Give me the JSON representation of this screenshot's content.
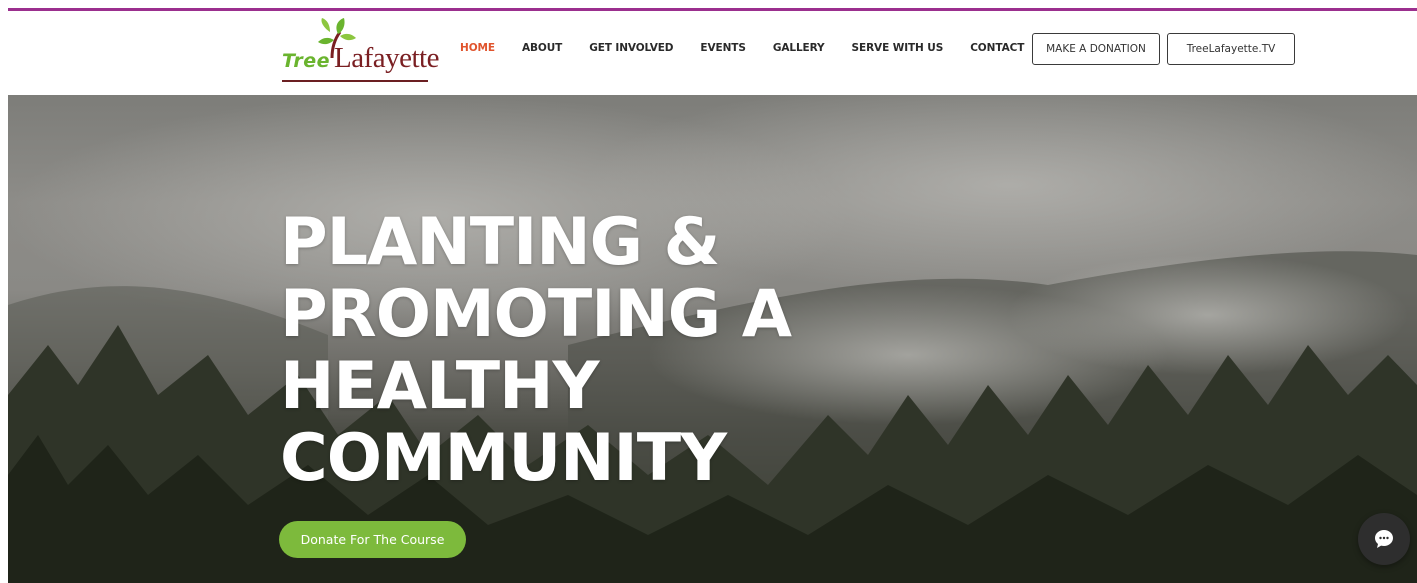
{
  "logo": {
    "word1": "Tree",
    "word2": "Lafayette",
    "alt": "Tree Lafayette"
  },
  "nav": {
    "items": [
      {
        "label": "HOME",
        "active": true
      },
      {
        "label": "ABOUT",
        "active": false
      },
      {
        "label": "GET INVOLVED",
        "active": false
      },
      {
        "label": "EVENTS",
        "active": false
      },
      {
        "label": "GALLERY",
        "active": false
      },
      {
        "label": "SERVE WITH US",
        "active": false
      },
      {
        "label": "CONTACT",
        "active": false
      }
    ]
  },
  "header_buttons": {
    "donation": "MAKE A DONATION",
    "tv": "TreeLafayette.TV"
  },
  "hero": {
    "headline": [
      "PLANTING &",
      "PROMOTING A",
      "HEALTHY",
      "COMMUNITY"
    ],
    "cta": "Donate For The Course"
  },
  "chat": {
    "icon": "chat-bubble-icon"
  },
  "colors": {
    "accent_bar": "#9b2f8e",
    "nav_active": "#e0542d",
    "cta": "#7dba3c",
    "logo_green": "#6ab42e",
    "logo_maroon": "#7a1f22"
  }
}
